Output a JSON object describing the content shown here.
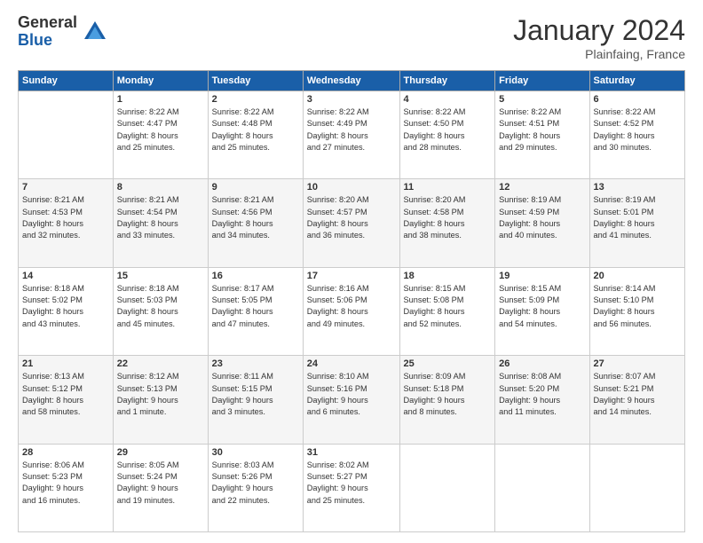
{
  "header": {
    "logo_general": "General",
    "logo_blue": "Blue",
    "title": "January 2024",
    "location": "Plainfaing, France"
  },
  "weekdays": [
    "Sunday",
    "Monday",
    "Tuesday",
    "Wednesday",
    "Thursday",
    "Friday",
    "Saturday"
  ],
  "weeks": [
    [
      {
        "day": "",
        "info": ""
      },
      {
        "day": "1",
        "info": "Sunrise: 8:22 AM\nSunset: 4:47 PM\nDaylight: 8 hours\nand 25 minutes."
      },
      {
        "day": "2",
        "info": "Sunrise: 8:22 AM\nSunset: 4:48 PM\nDaylight: 8 hours\nand 25 minutes."
      },
      {
        "day": "3",
        "info": "Sunrise: 8:22 AM\nSunset: 4:49 PM\nDaylight: 8 hours\nand 27 minutes."
      },
      {
        "day": "4",
        "info": "Sunrise: 8:22 AM\nSunset: 4:50 PM\nDaylight: 8 hours\nand 28 minutes."
      },
      {
        "day": "5",
        "info": "Sunrise: 8:22 AM\nSunset: 4:51 PM\nDaylight: 8 hours\nand 29 minutes."
      },
      {
        "day": "6",
        "info": "Sunrise: 8:22 AM\nSunset: 4:52 PM\nDaylight: 8 hours\nand 30 minutes."
      }
    ],
    [
      {
        "day": "7",
        "info": "Sunrise: 8:21 AM\nSunset: 4:53 PM\nDaylight: 8 hours\nand 32 minutes."
      },
      {
        "day": "8",
        "info": "Sunrise: 8:21 AM\nSunset: 4:54 PM\nDaylight: 8 hours\nand 33 minutes."
      },
      {
        "day": "9",
        "info": "Sunrise: 8:21 AM\nSunset: 4:56 PM\nDaylight: 8 hours\nand 34 minutes."
      },
      {
        "day": "10",
        "info": "Sunrise: 8:20 AM\nSunset: 4:57 PM\nDaylight: 8 hours\nand 36 minutes."
      },
      {
        "day": "11",
        "info": "Sunrise: 8:20 AM\nSunset: 4:58 PM\nDaylight: 8 hours\nand 38 minutes."
      },
      {
        "day": "12",
        "info": "Sunrise: 8:19 AM\nSunset: 4:59 PM\nDaylight: 8 hours\nand 40 minutes."
      },
      {
        "day": "13",
        "info": "Sunrise: 8:19 AM\nSunset: 5:01 PM\nDaylight: 8 hours\nand 41 minutes."
      }
    ],
    [
      {
        "day": "14",
        "info": "Sunrise: 8:18 AM\nSunset: 5:02 PM\nDaylight: 8 hours\nand 43 minutes."
      },
      {
        "day": "15",
        "info": "Sunrise: 8:18 AM\nSunset: 5:03 PM\nDaylight: 8 hours\nand 45 minutes."
      },
      {
        "day": "16",
        "info": "Sunrise: 8:17 AM\nSunset: 5:05 PM\nDaylight: 8 hours\nand 47 minutes."
      },
      {
        "day": "17",
        "info": "Sunrise: 8:16 AM\nSunset: 5:06 PM\nDaylight: 8 hours\nand 49 minutes."
      },
      {
        "day": "18",
        "info": "Sunrise: 8:15 AM\nSunset: 5:08 PM\nDaylight: 8 hours\nand 52 minutes."
      },
      {
        "day": "19",
        "info": "Sunrise: 8:15 AM\nSunset: 5:09 PM\nDaylight: 8 hours\nand 54 minutes."
      },
      {
        "day": "20",
        "info": "Sunrise: 8:14 AM\nSunset: 5:10 PM\nDaylight: 8 hours\nand 56 minutes."
      }
    ],
    [
      {
        "day": "21",
        "info": "Sunrise: 8:13 AM\nSunset: 5:12 PM\nDaylight: 8 hours\nand 58 minutes."
      },
      {
        "day": "22",
        "info": "Sunrise: 8:12 AM\nSunset: 5:13 PM\nDaylight: 9 hours\nand 1 minute."
      },
      {
        "day": "23",
        "info": "Sunrise: 8:11 AM\nSunset: 5:15 PM\nDaylight: 9 hours\nand 3 minutes."
      },
      {
        "day": "24",
        "info": "Sunrise: 8:10 AM\nSunset: 5:16 PM\nDaylight: 9 hours\nand 6 minutes."
      },
      {
        "day": "25",
        "info": "Sunrise: 8:09 AM\nSunset: 5:18 PM\nDaylight: 9 hours\nand 8 minutes."
      },
      {
        "day": "26",
        "info": "Sunrise: 8:08 AM\nSunset: 5:20 PM\nDaylight: 9 hours\nand 11 minutes."
      },
      {
        "day": "27",
        "info": "Sunrise: 8:07 AM\nSunset: 5:21 PM\nDaylight: 9 hours\nand 14 minutes."
      }
    ],
    [
      {
        "day": "28",
        "info": "Sunrise: 8:06 AM\nSunset: 5:23 PM\nDaylight: 9 hours\nand 16 minutes."
      },
      {
        "day": "29",
        "info": "Sunrise: 8:05 AM\nSunset: 5:24 PM\nDaylight: 9 hours\nand 19 minutes."
      },
      {
        "day": "30",
        "info": "Sunrise: 8:03 AM\nSunset: 5:26 PM\nDaylight: 9 hours\nand 22 minutes."
      },
      {
        "day": "31",
        "info": "Sunrise: 8:02 AM\nSunset: 5:27 PM\nDaylight: 9 hours\nand 25 minutes."
      },
      {
        "day": "",
        "info": ""
      },
      {
        "day": "",
        "info": ""
      },
      {
        "day": "",
        "info": ""
      }
    ]
  ]
}
